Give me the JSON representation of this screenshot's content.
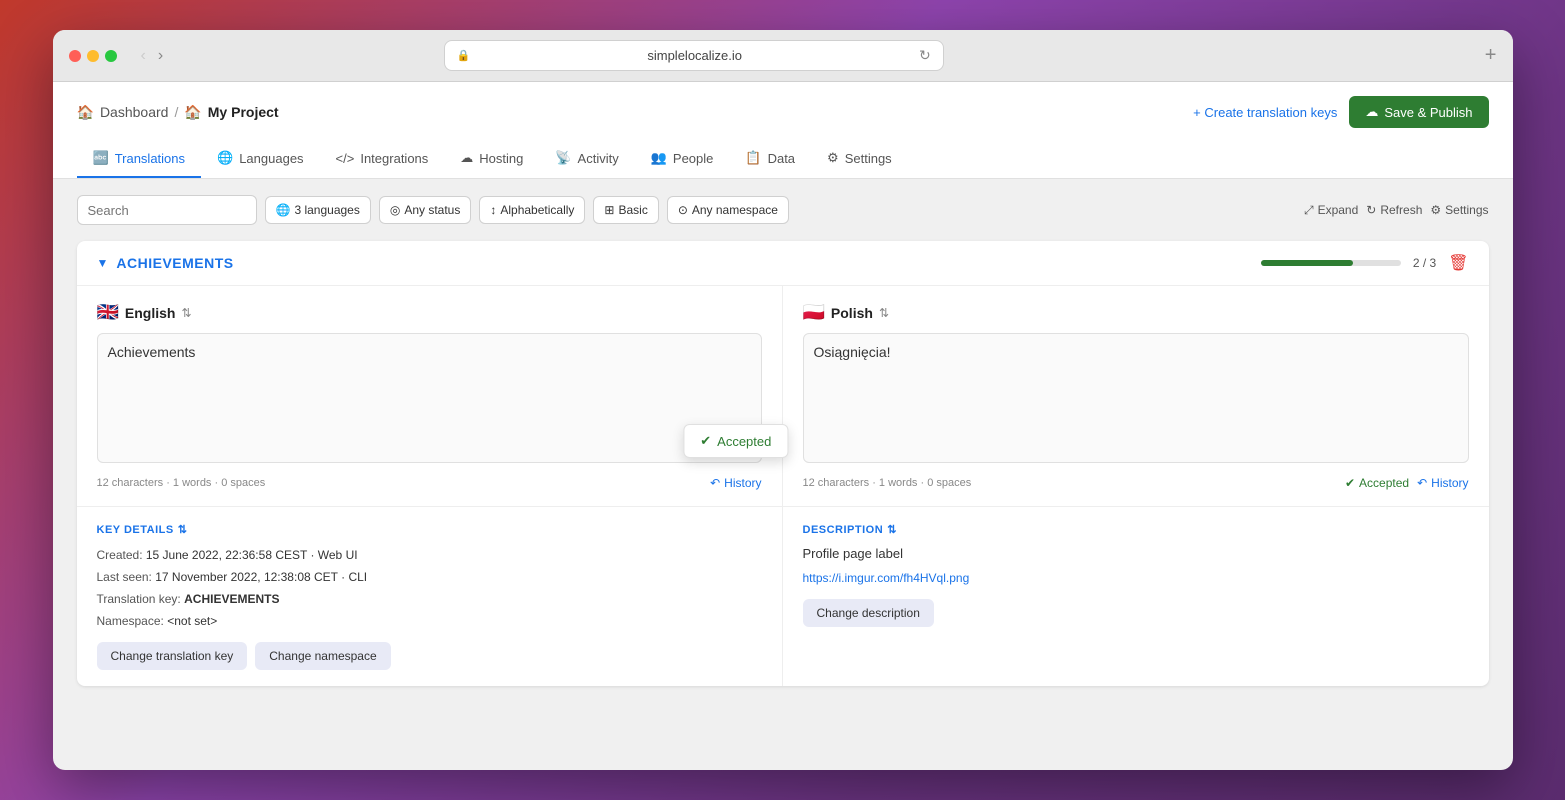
{
  "window": {
    "title": "simplelocalize.io",
    "traffic_lights": [
      "red",
      "yellow",
      "green"
    ]
  },
  "breadcrumb": {
    "home_label": "Dashboard",
    "separator": "/",
    "project_emoji": "🏠",
    "project_name": "My Project"
  },
  "header_actions": {
    "create_key_label": "+ Create translation keys",
    "save_publish_label": "Save & Publish"
  },
  "nav": {
    "tabs": [
      {
        "id": "translations",
        "label": "Translations",
        "active": true,
        "icon": "ab-icon"
      },
      {
        "id": "languages",
        "label": "Languages",
        "icon": "globe-icon"
      },
      {
        "id": "integrations",
        "label": "Integrations",
        "icon": "code-icon"
      },
      {
        "id": "hosting",
        "label": "Hosting",
        "icon": "cloud-icon"
      },
      {
        "id": "activity",
        "label": "Activity",
        "icon": "radio-icon"
      },
      {
        "id": "people",
        "label": "People",
        "icon": "people-icon"
      },
      {
        "id": "data",
        "label": "Data",
        "icon": "data-icon"
      },
      {
        "id": "settings",
        "label": "Settings",
        "icon": "gear-icon"
      }
    ]
  },
  "toolbar": {
    "search_placeholder": "Search",
    "languages_filter": "3 languages",
    "status_filter": "Any status",
    "sort_filter": "Alphabetically",
    "view_filter": "Basic",
    "namespace_filter": "Any namespace",
    "expand_label": "Expand",
    "refresh_label": "Refresh",
    "settings_label": "Settings"
  },
  "section": {
    "title": "ACHIEVEMENTS",
    "progress_value": 66,
    "progress_label": "2 / 3"
  },
  "english_col": {
    "flag": "🇬🇧",
    "lang_name": "English",
    "translation_text": "Achievements",
    "char_info": "12 characters · 1 words · 0 spaces",
    "accepted_label": "Accepted",
    "history_label": "History"
  },
  "polish_col": {
    "flag": "🇵🇱",
    "lang_name": "Polish",
    "translation_text": "Osiągnięcia!",
    "char_info": "12 characters · 1 words · 0 spaces",
    "accepted_label": "Accepted",
    "history_label": "History"
  },
  "key_details": {
    "title": "KEY DETAILS",
    "created_label": "Created:",
    "created_value": "15 June 2022, 22:36:58 CEST · Web UI",
    "last_seen_label": "Last seen:",
    "last_seen_value": "17 November 2022, 12:38:08 CET · CLI",
    "translation_key_label": "Translation key:",
    "translation_key_value": "ACHIEVEMENTS",
    "namespace_label": "Namespace:",
    "namespace_value": "<not set>",
    "change_key_label": "Change translation key",
    "change_namespace_label": "Change namespace"
  },
  "description": {
    "title": "DESCRIPTION",
    "text": "Profile page label",
    "link": "https://i.imgur.com/fh4HVql.png",
    "change_label": "Change description"
  },
  "popup": {
    "accepted_label": "Accepted"
  }
}
